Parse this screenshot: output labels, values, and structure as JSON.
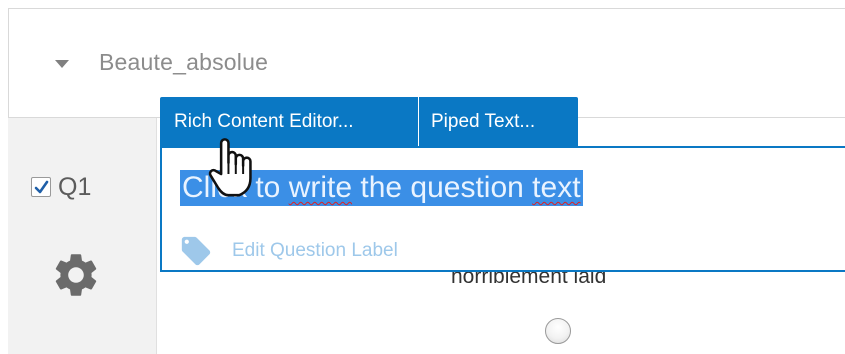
{
  "block": {
    "title": "Beaute_absolue"
  },
  "question": {
    "number": "Q1",
    "checked": true,
    "text_prefix": "Click to ",
    "text_word": "write",
    "text_mid": " the question ",
    "text_suffix": "text",
    "label_link": "Edit Question Label"
  },
  "editor_tabs": [
    {
      "label": "Rich Content Editor..."
    },
    {
      "label": "Piped Text..."
    }
  ],
  "choices": [
    {
      "label": "horriblement laid",
      "selected": false
    }
  ],
  "icons": {
    "block_toggle": "caret-down-icon",
    "settings": "gear-icon",
    "label": "tag-icon",
    "cursor": "hand-pointer-icon",
    "checkbox": "checkmark-icon"
  },
  "colors": {
    "accent": "#0a78c4",
    "selection": "#3b8fe6",
    "label_link": "#9ec8ea",
    "spellcheck": "#e02020"
  }
}
